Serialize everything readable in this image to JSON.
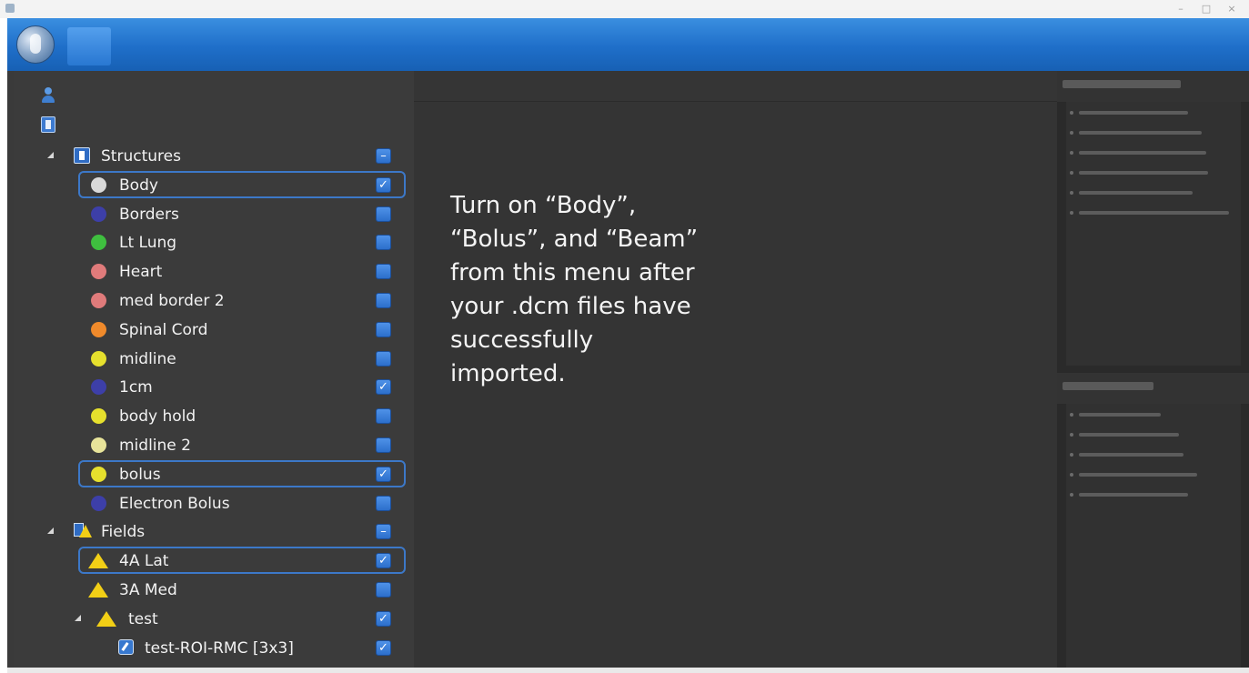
{
  "tree": {
    "structures_label": "Structures",
    "structures": [
      {
        "label": "Body",
        "color": "#d9d9d9",
        "checked": true,
        "highlighted": true
      },
      {
        "label": "Borders",
        "color": "#3d3fa8",
        "checked": false,
        "highlighted": false
      },
      {
        "label": "Lt Lung",
        "color": "#3fbf3f",
        "checked": false,
        "highlighted": false
      },
      {
        "label": "Heart",
        "color": "#e07b7b",
        "checked": false,
        "highlighted": false
      },
      {
        "label": "med border 2",
        "color": "#e07b7b",
        "checked": false,
        "highlighted": false
      },
      {
        "label": "Spinal Cord",
        "color": "#f08a2b",
        "checked": false,
        "highlighted": false
      },
      {
        "label": "midline",
        "color": "#e6e02d",
        "checked": false,
        "highlighted": false
      },
      {
        "label": "1cm",
        "color": "#3d3fa8",
        "checked": true,
        "highlighted": false
      },
      {
        "label": "body hold",
        "color": "#e6e02d",
        "checked": false,
        "highlighted": false
      },
      {
        "label": "midline 2",
        "color": "#e8e49a",
        "checked": false,
        "highlighted": false
      },
      {
        "label": "bolus",
        "color": "#e6e02d",
        "checked": true,
        "highlighted": true
      },
      {
        "label": "Electron Bolus",
        "color": "#3d3fa8",
        "checked": false,
        "highlighted": false
      }
    ],
    "fields_label": "Fields",
    "fields": [
      {
        "label": "4A Lat",
        "checked": true,
        "highlighted": true
      },
      {
        "label": "3A Med",
        "checked": false,
        "highlighted": false
      }
    ],
    "test_label": "test",
    "test_checked": true,
    "roi_label": "test-ROI-RMC [3x3]",
    "roi_checked": true,
    "check_mark": "✓",
    "partial_mark": "–",
    "expanded_glyph": "◢"
  },
  "instruction": "Turn on “Body”,\n“Bolus”, and “Beam”\nfrom this menu after\nyour .dcm files have\nsuccessfully\nimported.",
  "window_controls": {
    "minimize": "–",
    "maximize": "□",
    "close": "×"
  },
  "colors": {
    "ribbon": "#1f6fc9",
    "panel_bg": "#3b3b3b",
    "highlight_border": "#3c78c8",
    "checkbox": "#3c7fd8",
    "field_triangle": "#f2cf16"
  },
  "icons": [
    "person-icon",
    "structure-set-icon",
    "structures-icon",
    "fields-icon",
    "beam-icon",
    "roi-icon"
  ]
}
